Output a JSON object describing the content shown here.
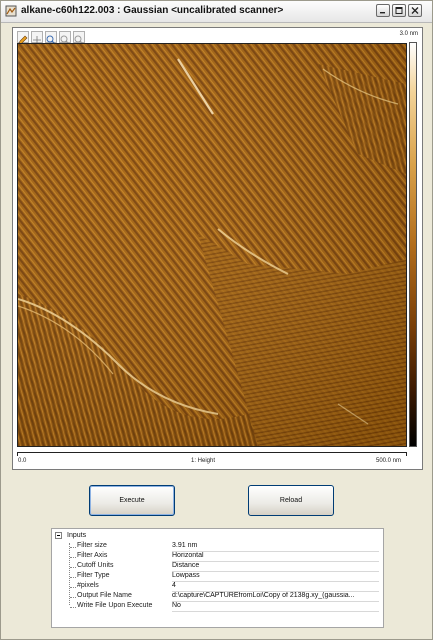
{
  "window": {
    "title": "alkane-c60h122.003 : Gaussian <uncalibrated scanner>",
    "buttons": {
      "minimize": "minimize-icon",
      "maximize": "maximize-icon",
      "close": "close-icon"
    }
  },
  "image_panel": {
    "toolbar": [
      "pencil-icon",
      "crosshair-icon",
      "zoom-in-icon",
      "zoom-out-icon",
      "zoom-reset-icon"
    ],
    "scale_max": "3.0 nm",
    "axis_start": "0.0",
    "axis_title": "1: Height",
    "axis_end": "500.0 nm",
    "colors": {
      "dark": "#3d1a02",
      "mid": "#b26d1c",
      "light": "#f3d49a"
    }
  },
  "actions": {
    "execute_label": "Execute",
    "reload_label": "Reload"
  },
  "inputs": {
    "header": "Inputs",
    "rows": [
      {
        "label": "Filter size",
        "value": "3.91 nm"
      },
      {
        "label": "Filter Axis",
        "value": "Horizontal"
      },
      {
        "label": "Cutoff Units",
        "value": "Distance"
      },
      {
        "label": "Filter Type",
        "value": "Lowpass"
      },
      {
        "label": "#pixels",
        "value": "4"
      },
      {
        "label": "Output File Name",
        "value": "d:\\capture\\CAPTUREfromLoi\\Copy of 2138g.xy_(gaussia..."
      },
      {
        "label": "Write File Upon Execute",
        "value": "No"
      }
    ]
  }
}
